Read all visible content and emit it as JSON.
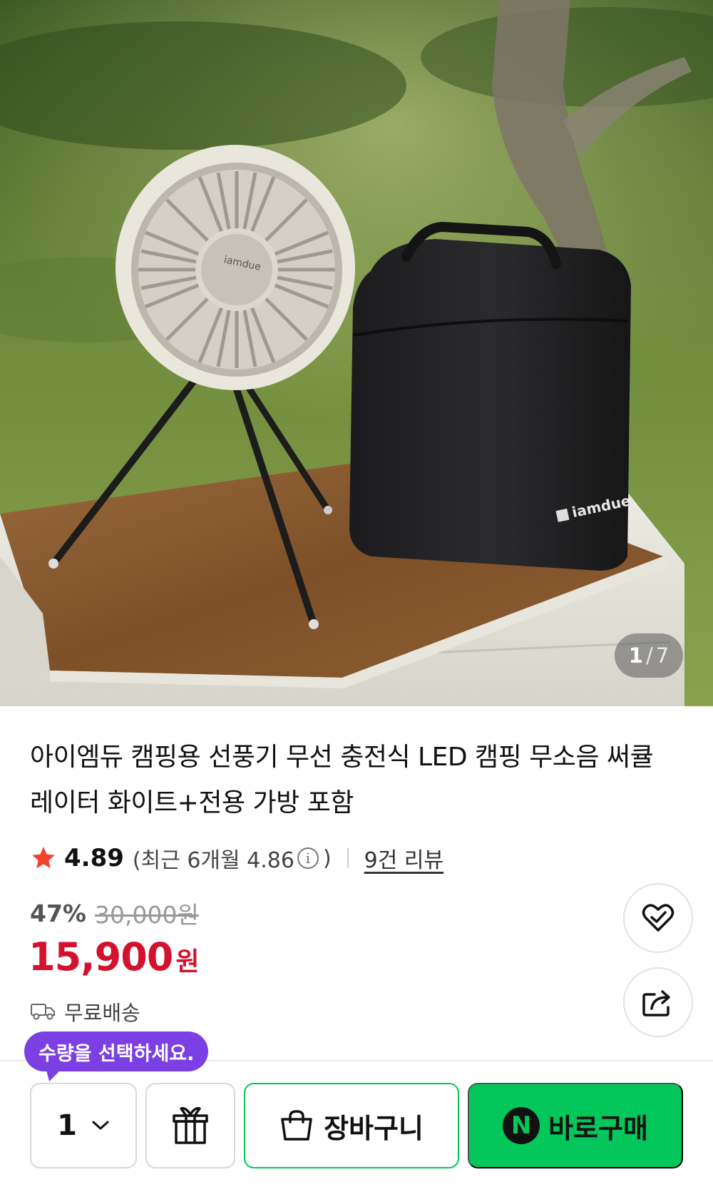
{
  "gallery": {
    "current": "1",
    "separator": "/",
    "total": "7",
    "image_alt": "iamdue camping fan with tripod and black carry bag on a wooden table",
    "fan_brand_text": "iamdue",
    "bag_brand_text": "iamdue"
  },
  "product": {
    "title": "아이엠듀 캠핑용 선풍기 무선 충전식 LED 캠핑 무소음 써큘레이터 화이트+전용 가방 포함",
    "rating": "4.89",
    "recent_rating_prefix": "(최근 6개월 4.86",
    "recent_rating_suffix": ")",
    "info_icon": "i",
    "review_link": "9건 리뷰",
    "discount_rate": "47%",
    "original_price": "30,000원",
    "price": "15,900",
    "price_unit": "원",
    "shipping": "무료배송"
  },
  "icons": {
    "star": "star-icon",
    "truck": "truck-icon",
    "wish": "heart-check-icon",
    "share": "share-icon",
    "chevron": "chevron-down-icon",
    "gift": "gift-icon",
    "cart": "shopping-bag-icon",
    "npay": "naver-pay-icon"
  },
  "bottom_bar": {
    "tooltip": "수량을 선택하세요.",
    "quantity": "1",
    "cart_label": "장바구니",
    "npay_letter": "N",
    "buy_label": "바로구매"
  },
  "colors": {
    "price_red": "#d2122e",
    "star": "#f5412c",
    "naver_green": "#03c75a",
    "tooltip_purple": "#7b3fe4"
  }
}
